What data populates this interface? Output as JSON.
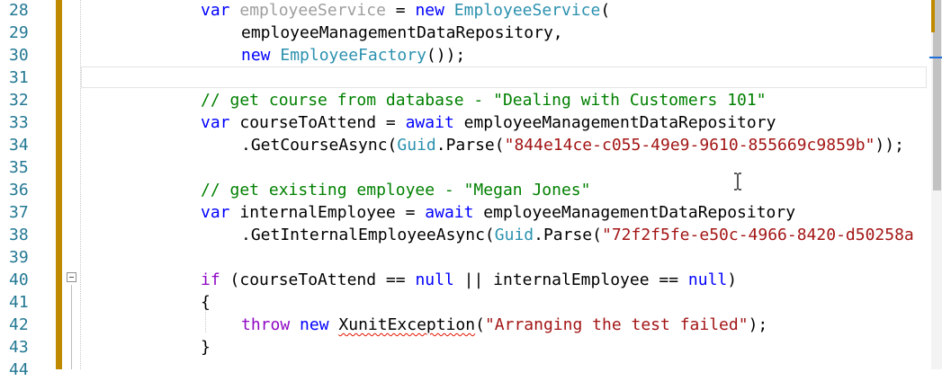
{
  "editor": {
    "line_numbers": [
      "28",
      "29",
      "30",
      "31",
      "32",
      "33",
      "34",
      "35",
      "36",
      "37",
      "38",
      "39",
      "40",
      "41",
      "42",
      "43",
      "44"
    ],
    "lines": [
      [
        {
          "t": "var",
          "c": "kw"
        },
        {
          "t": " "
        },
        {
          "t": "employeeService",
          "c": "dim"
        },
        {
          "t": " = "
        },
        {
          "t": "new",
          "c": "kw"
        },
        {
          "t": " "
        },
        {
          "t": "EmployeeService",
          "c": "type"
        },
        {
          "t": "("
        }
      ],
      [
        {
          "t": "employeeManagementDataRepository,"
        }
      ],
      [
        {
          "t": "new",
          "c": "kw"
        },
        {
          "t": " "
        },
        {
          "t": "EmployeeFactory",
          "c": "type"
        },
        {
          "t": "());"
        }
      ],
      [],
      [
        {
          "t": "// get course from database - \"Dealing with Customers 101\"",
          "c": "cmt"
        }
      ],
      [
        {
          "t": "var",
          "c": "kw"
        },
        {
          "t": " courseToAttend = "
        },
        {
          "t": "await",
          "c": "kw"
        },
        {
          "t": " employeeManagementDataRepository"
        }
      ],
      [
        {
          "t": ".GetCourseAsync("
        },
        {
          "t": "Guid",
          "c": "type"
        },
        {
          "t": ".Parse("
        },
        {
          "t": "\"844e14ce-c055-49e9-9610-855669c9859b\"",
          "c": "str"
        },
        {
          "t": "));"
        }
      ],
      [],
      [
        {
          "t": "// get existing employee - \"Megan Jones\"",
          "c": "cmt"
        }
      ],
      [
        {
          "t": "var",
          "c": "kw"
        },
        {
          "t": " internalEmployee = "
        },
        {
          "t": "await",
          "c": "kw"
        },
        {
          "t": " employeeManagementDataRepository"
        }
      ],
      [
        {
          "t": ".GetInternalEmployeeAsync("
        },
        {
          "t": "Guid",
          "c": "type"
        },
        {
          "t": ".Parse("
        },
        {
          "t": "\"72f2f5fe-e50c-4966-8420-d50258a",
          "c": "str"
        }
      ],
      [],
      [
        {
          "t": "if",
          "c": "ctl"
        },
        {
          "t": " (courseToAttend == "
        },
        {
          "t": "null",
          "c": "kw"
        },
        {
          "t": " || internalEmployee == "
        },
        {
          "t": "null",
          "c": "kw"
        },
        {
          "t": ")"
        }
      ],
      [
        {
          "t": "{"
        }
      ],
      [
        {
          "t": "throw",
          "c": "ctl"
        },
        {
          "t": " "
        },
        {
          "t": "new",
          "c": "kw"
        },
        {
          "t": " "
        },
        {
          "t": "XunitException",
          "c": "squig"
        },
        {
          "t": "("
        },
        {
          "t": "\"Arranging the test failed\"",
          "c": "str"
        },
        {
          "t": ");"
        }
      ],
      [
        {
          "t": "}"
        }
      ],
      []
    ]
  },
  "colors": {
    "keyword": "#0000ff",
    "control_keyword": "#8f08c4",
    "type": "#2b91af",
    "string": "#a31515",
    "comment": "#008000",
    "line_number": "#237893",
    "change_bar": "#c08a00"
  },
  "icons": {
    "fold_toggle": "collapse-minus-icon",
    "mouse_cursor": "text-ibeam-cursor-icon"
  }
}
